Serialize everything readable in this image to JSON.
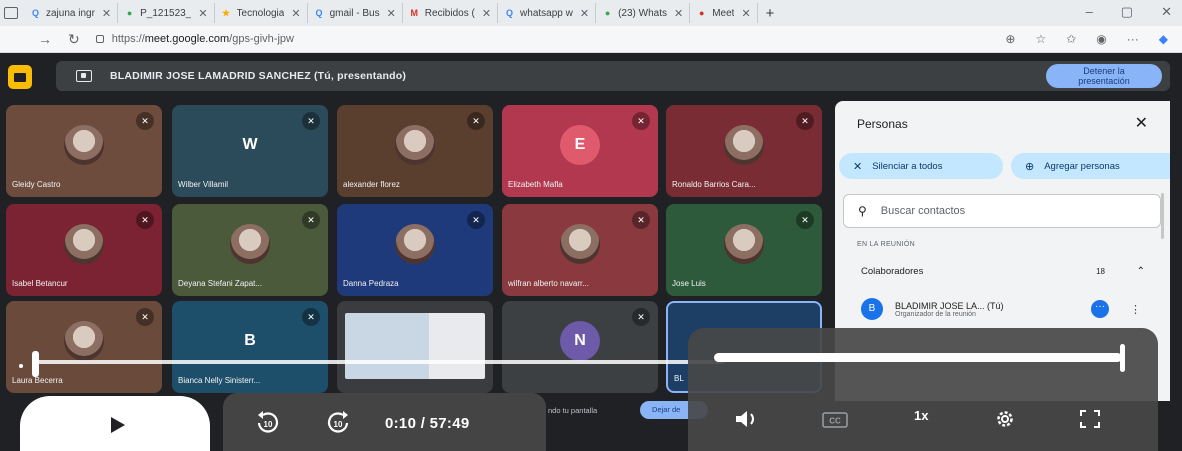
{
  "browser": {
    "tabs": [
      {
        "title": "zajuna ingr",
        "icon_color": "#4285f4",
        "icon": "Q"
      },
      {
        "title": "P_121523_",
        "icon_color": "#34a853",
        "icon": "●"
      },
      {
        "title": "Tecnologia",
        "icon_color": "#f9ab00",
        "icon": "★"
      },
      {
        "title": "gmail - Bus",
        "icon_color": "#4285f4",
        "icon": "Q"
      },
      {
        "title": "Recibidos (",
        "icon_color": "#d93025",
        "icon": "M"
      },
      {
        "title": "whatsapp w",
        "icon_color": "#4285f4",
        "icon": "Q"
      },
      {
        "title": "(23) Whats",
        "icon_color": "#34a853",
        "icon": "●"
      },
      {
        "title": "Meet",
        "icon_color": "#d93025",
        "icon": "●"
      }
    ],
    "url_prefix": "https://",
    "url_host": "meet.google.com",
    "url_path": "/gps-givh-jpw"
  },
  "meet": {
    "presenter_text": "BLADIMIR JOSE LAMADRID SANCHEZ (Tú, presentando)",
    "stop_label_1": "Detener la",
    "stop_label_2": "presentación",
    "participants": [
      {
        "name": "Gleidy Castro",
        "bg": "#6d4c3d",
        "avatar": "photo"
      },
      {
        "name": "Wilber Villamil",
        "bg": "#2b4a5a",
        "avatar": "W",
        "avatar_bg": "transparent"
      },
      {
        "name": "alexander florez",
        "bg": "#5a3e2e",
        "avatar": "photo"
      },
      {
        "name": "Elizabeth Mafla",
        "bg": "#b2384f",
        "avatar": "E",
        "avatar_bg": "#e05a6d"
      },
      {
        "name": "Ronaldo Barrios Cara...",
        "bg": "#7a2c34",
        "avatar": "photo"
      },
      {
        "name": "Isabel Betancur",
        "bg": "#7b2332",
        "avatar": "photo"
      },
      {
        "name": "Deyana Stefani Zapat...",
        "bg": "#4a5a3a",
        "avatar": "photo"
      },
      {
        "name": "Danna Pedraza",
        "bg": "#1f3a7a",
        "avatar": "photo"
      },
      {
        "name": "wilfran alberto navarr...",
        "bg": "#8a3a3e",
        "avatar": "photo"
      },
      {
        "name": "Jose Luis",
        "bg": "#2d5a3a",
        "avatar": "photo"
      },
      {
        "name": "Laura Becerra",
        "bg": "#6a4a3a",
        "avatar": "photo"
      },
      {
        "name": "Bianca Nelly Sinisterr...",
        "bg": "#1e4f6a",
        "avatar": "B",
        "avatar_bg": "transparent"
      },
      {
        "name": "",
        "bg": "#3a3c40",
        "avatar": "screen"
      },
      {
        "name": "",
        "bg": "#3c4043",
        "avatar": "N",
        "avatar_bg": "#6d5aa8"
      },
      {
        "name": "BL",
        "bg": "#1d3f66",
        "avatar": "none"
      }
    ],
    "mic_icon": "✕"
  },
  "people_panel": {
    "title": "Personas",
    "mute_all": "Silenciar a todos",
    "add_people": "Agregar personas",
    "search_placeholder": "Buscar contactos",
    "section_label": "EN LA REUNIÓN",
    "group_label": "Colaboradores",
    "group_count": "18",
    "member_initial": "B",
    "member_name": "BLADIMIR JOSE LA... (Tú)",
    "member_role": "Organizador de la reunión"
  },
  "bottom": {
    "share_text": "ndo tu pantalla",
    "share_btn": "Dejar de"
  },
  "player": {
    "current_time": "0:10",
    "duration": "/ 57:49",
    "progress_fraction": 0.0029,
    "volume_fraction": 1.0,
    "speed_label": "1x",
    "skip_seconds": "10"
  },
  "colors": {
    "accent": "#8ab4f8",
    "pill_blue": "#c2e7ff",
    "meet_yellow": "#fbbc04"
  }
}
